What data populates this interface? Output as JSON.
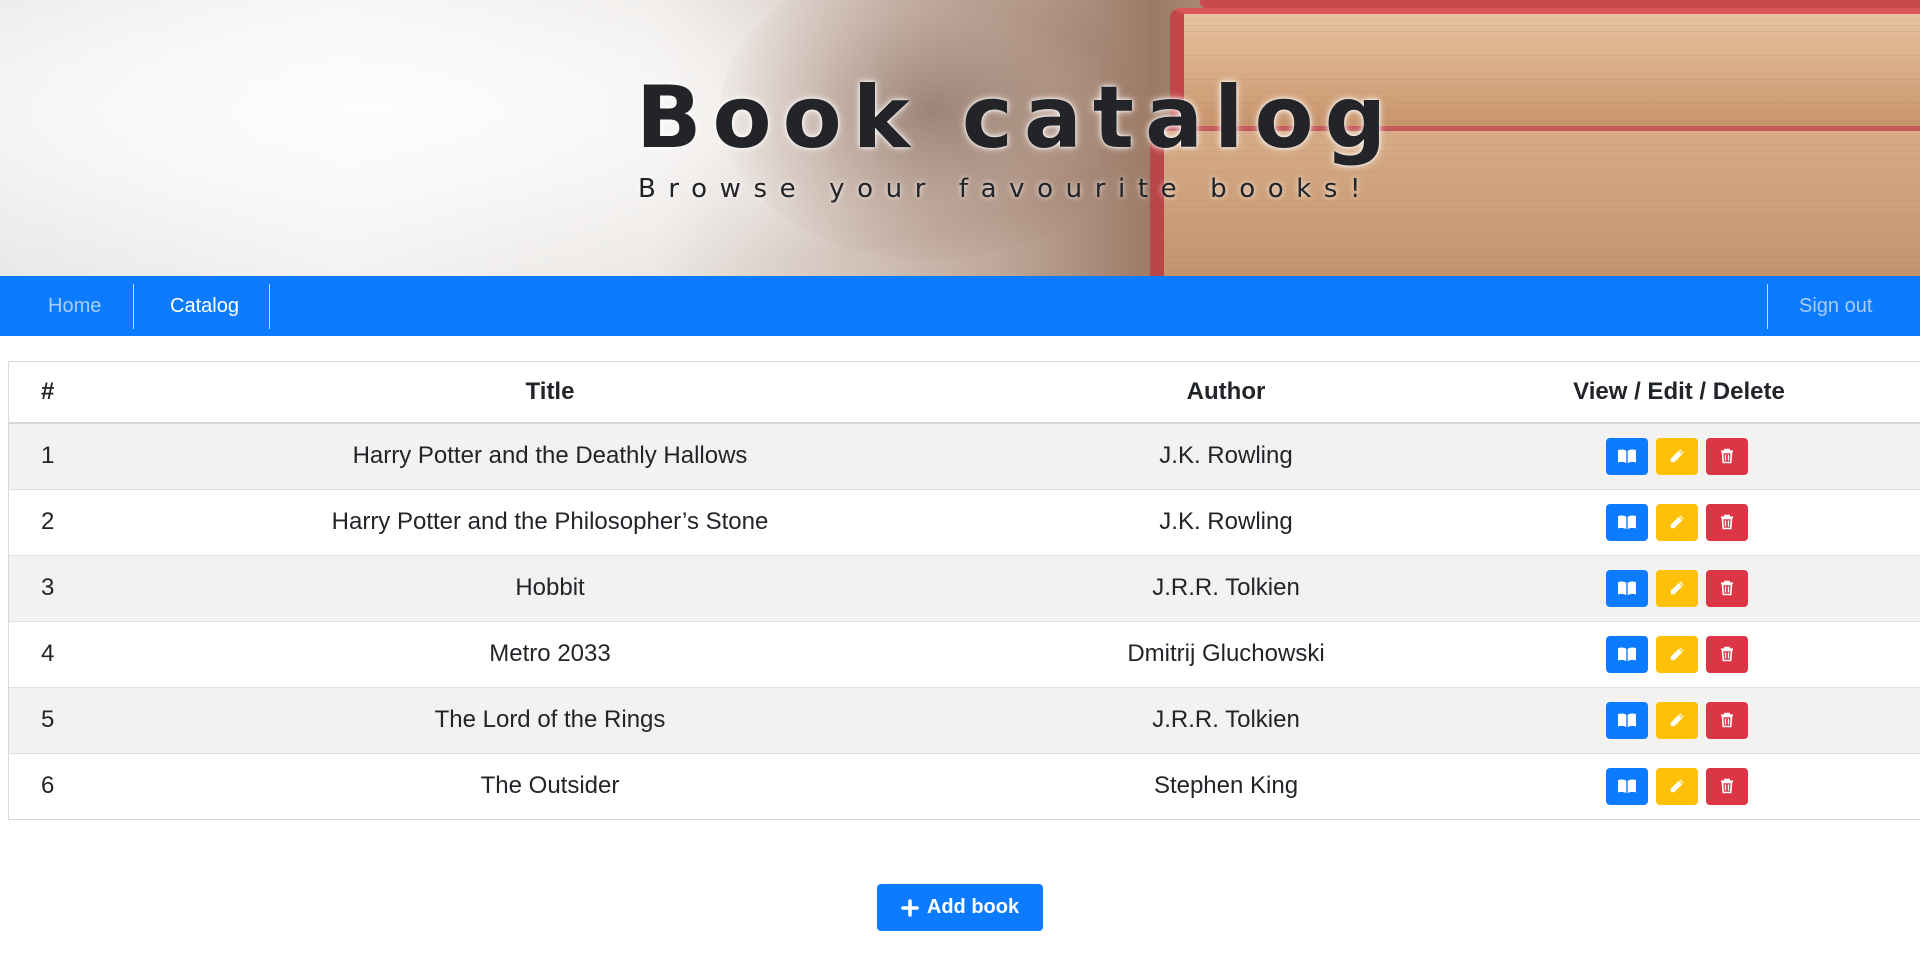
{
  "header": {
    "title": "Book catalog",
    "subtitle": "Browse your favourite books!"
  },
  "nav": {
    "home": "Home",
    "catalog": "Catalog",
    "sign_out": "Sign out",
    "active": "Catalog"
  },
  "table": {
    "columns": [
      "#",
      "Title",
      "Author",
      "View / Edit / Delete"
    ],
    "rows": [
      {
        "num": "1",
        "title": "Harry Potter and the Deathly Hallows",
        "author": "J.K. Rowling"
      },
      {
        "num": "2",
        "title": "Harry Potter and the Philosopher’s Stone",
        "author": "J.K. Rowling"
      },
      {
        "num": "3",
        "title": "Hobbit",
        "author": "J.R.R. Tolkien"
      },
      {
        "num": "4",
        "title": "Metro 2033",
        "author": "Dmitrij Gluchowski"
      },
      {
        "num": "5",
        "title": "The Lord of the Rings",
        "author": "J.R.R. Tolkien"
      },
      {
        "num": "6",
        "title": "The Outsider",
        "author": "Stephen King"
      }
    ],
    "row_actions": [
      {
        "name": "view",
        "icon": "book-open-icon",
        "color": "#0d7bff"
      },
      {
        "name": "edit",
        "icon": "pencil-icon",
        "color": "#ffc107"
      },
      {
        "name": "delete",
        "icon": "trash-icon",
        "color": "#dc3545"
      }
    ]
  },
  "add_button": {
    "label": "Add book",
    "icon": "plus-icon"
  },
  "colors": {
    "primary": "#0d7bff",
    "warning": "#ffc107",
    "danger": "#dc3545",
    "striped_row": "#f2f2f2"
  }
}
